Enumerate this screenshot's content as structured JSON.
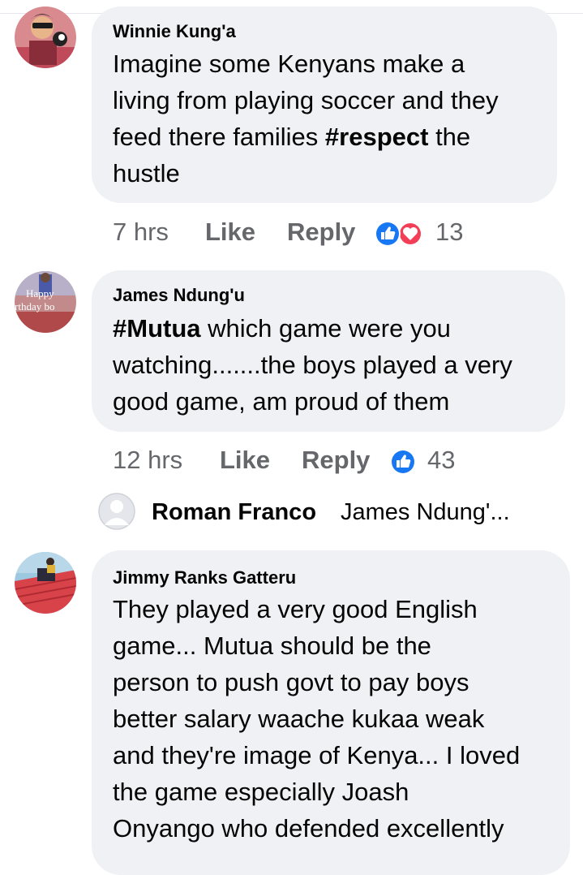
{
  "comments": [
    {
      "author": "Winnie Kung'a",
      "lines": [
        "Imagine some Kenyans make a",
        "living from playing soccer and they",
        "feed there families ",
        "hustle"
      ],
      "hashtag": "#respect",
      "line3_after": " the",
      "time": "7 hrs",
      "like_label": "Like",
      "reply_label": "Reply",
      "reaction_count": "13",
      "reactions": [
        "like-icon",
        "love-icon"
      ]
    },
    {
      "author": "James Ndung'u",
      "hashtag": "#Mutua",
      "line1_after": " which game were you",
      "lines": [
        "watching.......the boys played a very",
        "good game, am proud of them"
      ],
      "avatar_text": "Happy rthday bo",
      "time": "12 hrs",
      "like_label": "Like",
      "reply_label": "Reply",
      "reaction_count": "43",
      "reactions": [
        "like-icon"
      ]
    },
    {
      "author": "Jimmy Ranks Gatteru",
      "lines": [
        "They played a very good English",
        "game... Mutua should be the",
        "person to push govt to pay boys",
        "better salary waache kukaa weak",
        "and they're image of Kenya... I loved",
        "the game especially Joash",
        "Onyango who defended excellently"
      ]
    }
  ],
  "reply_preview": {
    "name": "Roman Franco",
    "text": "James Ndung'...",
    "avatar_icon": "default-profile-icon"
  },
  "colors": {
    "bubble": "#eff1f5",
    "meta_text": "#65676b",
    "like_blue": "#1877f2",
    "love_red": "#f33e58"
  }
}
